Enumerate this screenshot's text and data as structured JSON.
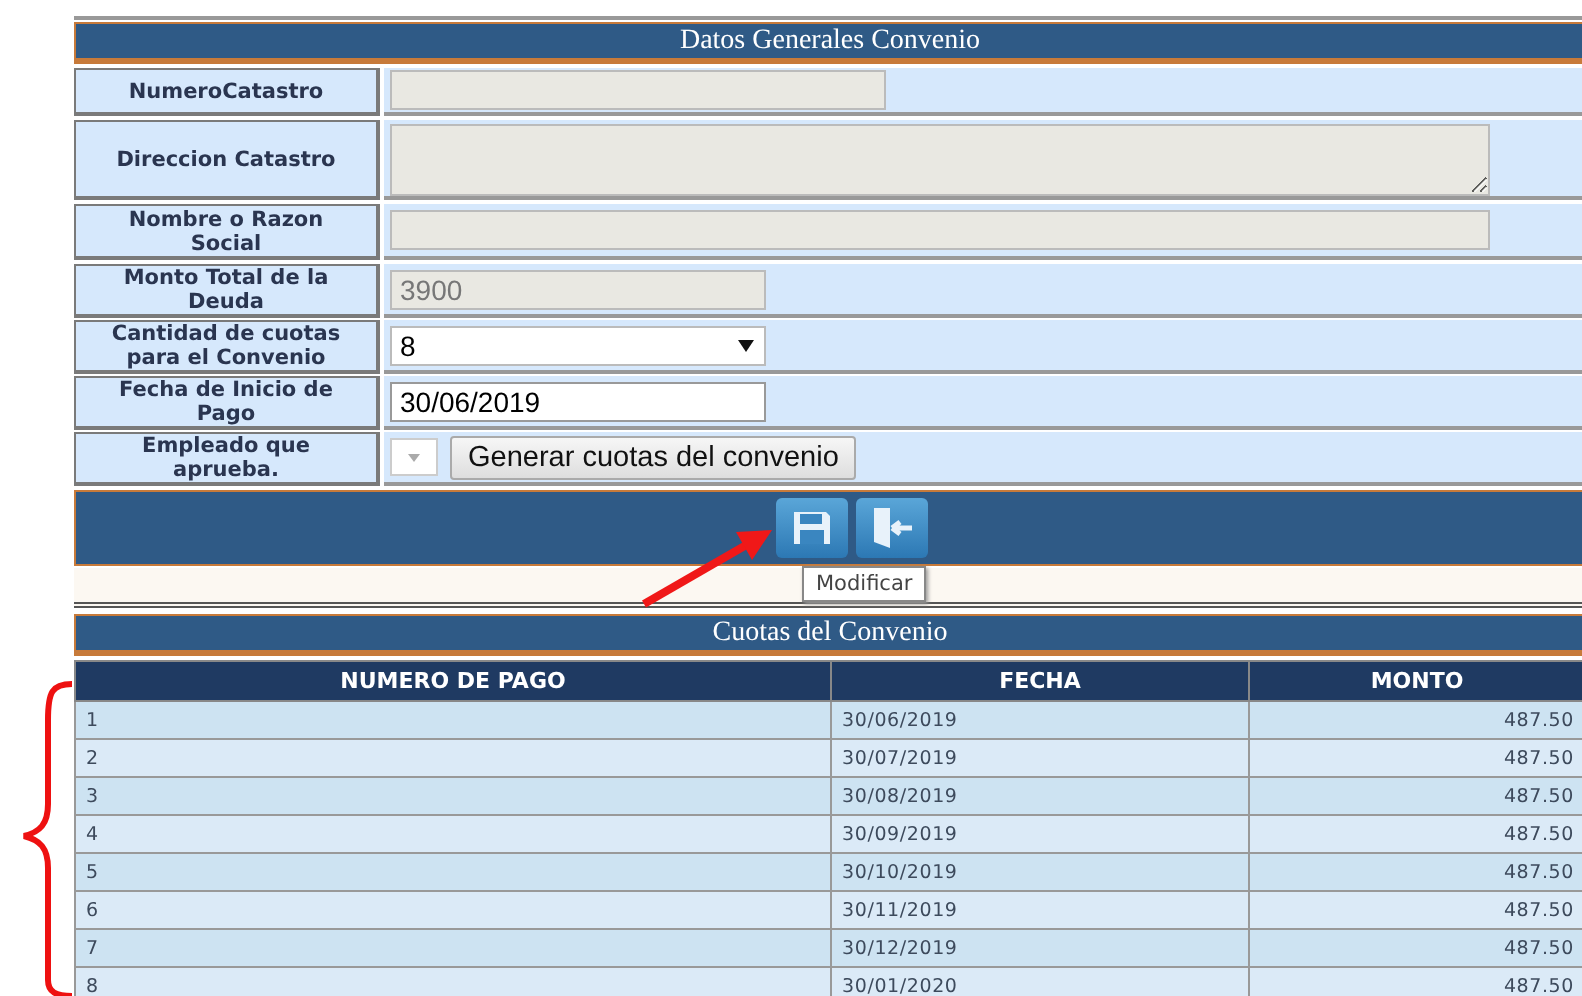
{
  "form": {
    "title": "Datos Generales Convenio",
    "fields": [
      {
        "label": "NumeroCatastro",
        "kind": "text",
        "disabled": true
      },
      {
        "label": "Direccion Catastro",
        "kind": "textarea",
        "disabled": true
      },
      {
        "label": "Nombre o Razon Social",
        "kind": "text",
        "disabled": true
      },
      {
        "label": "Monto Total de la Deuda",
        "kind": "text",
        "value": "3900",
        "disabled": true
      },
      {
        "label": "Cantidad de cuotas para el Convenio",
        "kind": "select",
        "value": "8"
      },
      {
        "label": "Fecha de Inicio de Pago",
        "kind": "text",
        "value": "30/06/2019",
        "disabled": false
      },
      {
        "label": "Empleado que aprueba.",
        "kind": "select-button",
        "button": "Generar cuotas del convenio"
      }
    ]
  },
  "toolbar": {
    "tooltip": "Modificar"
  },
  "table": {
    "title": "Cuotas del Convenio",
    "columns": [
      "NUMERO DE PAGO",
      "FECHA",
      "MONTO"
    ],
    "rows": [
      [
        "1",
        "30/06/2019",
        "487.50"
      ],
      [
        "2",
        "30/07/2019",
        "487.50"
      ],
      [
        "3",
        "30/08/2019",
        "487.50"
      ],
      [
        "4",
        "30/09/2019",
        "487.50"
      ],
      [
        "5",
        "30/10/2019",
        "487.50"
      ],
      [
        "6",
        "30/11/2019",
        "487.50"
      ],
      [
        "7",
        "30/12/2019",
        "487.50"
      ],
      [
        "8",
        "30/01/2020",
        "487.50"
      ]
    ]
  }
}
